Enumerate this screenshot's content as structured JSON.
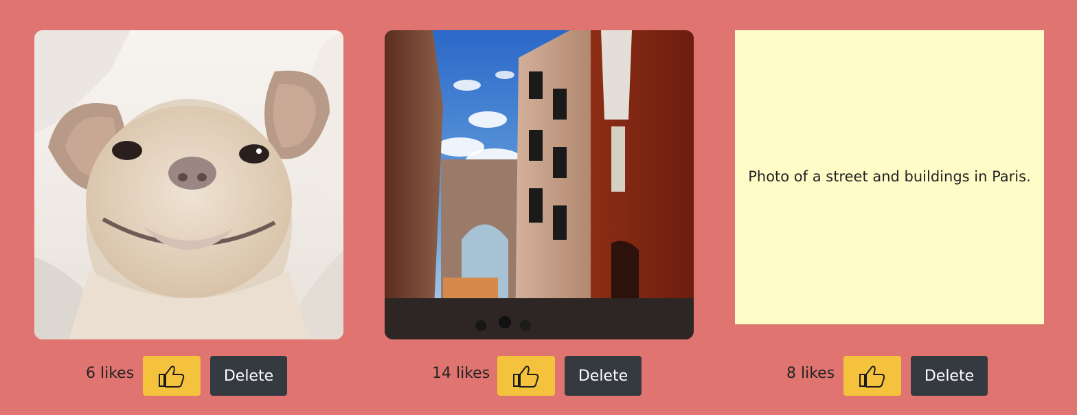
{
  "gallery": {
    "items": [
      {
        "likes_text": "6 likes",
        "like_icon": "thumbs-up-icon",
        "delete_label": "Delete"
      },
      {
        "likes_text": "14 likes",
        "like_icon": "thumbs-up-icon",
        "delete_label": "Delete"
      },
      {
        "alt_text": "Photo of a street and buildings in Paris.",
        "likes_text": "8 likes",
        "like_icon": "thumbs-up-icon",
        "delete_label": "Delete"
      }
    ]
  },
  "colors": {
    "background": "#e07470",
    "like_button": "#f5c23d",
    "delete_button": "#343a40",
    "placeholder_box": "#fffcc8"
  }
}
